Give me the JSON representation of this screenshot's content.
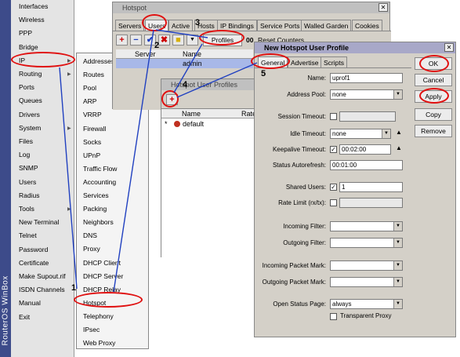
{
  "brand": {
    "text": "RouterOS WinBox"
  },
  "left_menu": {
    "items": [
      {
        "label": "Interfaces",
        "arrow": false
      },
      {
        "label": "Wireless",
        "arrow": false
      },
      {
        "label": "PPP",
        "arrow": false
      },
      {
        "label": "Bridge",
        "arrow": false
      },
      {
        "label": "IP",
        "arrow": true
      },
      {
        "label": "Routing",
        "arrow": true
      },
      {
        "label": "Ports",
        "arrow": false
      },
      {
        "label": "Queues",
        "arrow": false
      },
      {
        "label": "Drivers",
        "arrow": false
      },
      {
        "label": "System",
        "arrow": true
      },
      {
        "label": "Files",
        "arrow": false
      },
      {
        "label": "Log",
        "arrow": false
      },
      {
        "label": "SNMP",
        "arrow": false
      },
      {
        "label": "Users",
        "arrow": false
      },
      {
        "label": "Radius",
        "arrow": false
      },
      {
        "label": "Tools",
        "arrow": true
      },
      {
        "label": "New Terminal",
        "arrow": false
      },
      {
        "label": "Telnet",
        "arrow": false
      },
      {
        "label": "Password",
        "arrow": false
      },
      {
        "label": "Certificate",
        "arrow": false
      },
      {
        "label": "Make Supout.rif",
        "arrow": false
      },
      {
        "label": "ISDN Channels",
        "arrow": false
      },
      {
        "label": "Manual",
        "arrow": false
      },
      {
        "label": "Exit",
        "arrow": false
      }
    ]
  },
  "ip_submenu": {
    "items": [
      "Addresses",
      "Routes",
      "Pool",
      "ARP",
      "VRRP",
      "Firewall",
      "Socks",
      "UPnP",
      "Traffic Flow",
      "Accounting",
      "Services",
      "Packing",
      "Neighbors",
      "DNS",
      "Proxy",
      "DHCP Client",
      "DHCP Server",
      "DHCP Relay",
      "Hotspot",
      "Telephony",
      "IPsec",
      "Web Proxy"
    ]
  },
  "hotspot_window": {
    "title": "Hotspot",
    "tabs": [
      "Servers",
      "Users",
      "Active",
      "Hosts",
      "IP Bindings",
      "Service Ports",
      "Walled Garden",
      "Cookies"
    ],
    "profiles_button": "Profiles",
    "reset_counters": "Reset Counters",
    "columns": [
      "Server",
      "Name"
    ],
    "row": [
      "",
      "admin"
    ],
    "toolbar": {
      "add": "+",
      "remove": "−",
      "enable": "✔",
      "disable": "✖",
      "comment": "■",
      "filter": "▼"
    },
    "counter_label": "00"
  },
  "profiles_window": {
    "title": "Hotspot User Profiles",
    "columns": [
      "Name",
      "Rate"
    ],
    "row": {
      "marker": "*",
      "name": "default"
    }
  },
  "new_profile_window": {
    "title": "New Hotspot User Profile",
    "tabs": [
      "General",
      "Advertise",
      "Scripts"
    ],
    "buttons": {
      "ok": "OK",
      "cancel": "Cancel",
      "apply": "Apply",
      "copy": "Copy",
      "remove": "Remove"
    },
    "fields": {
      "name": {
        "label": "Name:",
        "value": "uprof1"
      },
      "address_pool": {
        "label": "Address Pool:",
        "value": "none"
      },
      "session_timeout": {
        "label": "Session Timeout:",
        "value": ""
      },
      "idle_timeout": {
        "label": "Idle Timeout:",
        "value": "none"
      },
      "keepalive_timeout": {
        "label": "Keepalive Timeout:",
        "value": "00:02:00"
      },
      "status_autorefresh": {
        "label": "Status Autorefresh:",
        "value": "00:01:00"
      },
      "shared_users": {
        "label": "Shared Users:",
        "value": "1"
      },
      "rate_limit": {
        "label": "Rate Limit (rx/tx):",
        "value": ""
      },
      "incoming_filter": {
        "label": "Incoming Filter:",
        "value": ""
      },
      "outgoing_filter": {
        "label": "Outgoing Filter:",
        "value": ""
      },
      "incoming_packet_mark": {
        "label": "Incoming Packet Mark:",
        "value": ""
      },
      "outgoing_packet_mark": {
        "label": "Outgoing Packet Mark:",
        "value": ""
      },
      "open_status_page": {
        "label": "Open Status Page:",
        "value": "always"
      },
      "transparent_proxy": {
        "label": "Transparent Proxy",
        "checked": false
      }
    }
  },
  "steps": [
    "1",
    "2",
    "3",
    "4",
    "5"
  ],
  "colors": {
    "annotation": "#e01010",
    "arrow": "#2040c0",
    "brand": "#3d4b8a"
  }
}
